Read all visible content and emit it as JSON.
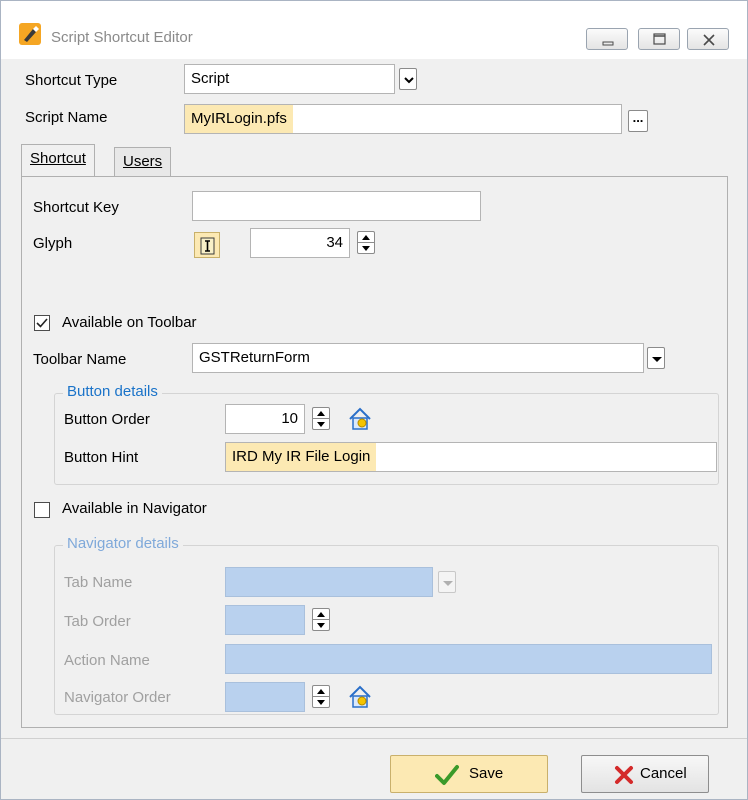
{
  "window": {
    "title": "Script Shortcut Editor",
    "buttons": [
      "minimize",
      "maximize",
      "close"
    ]
  },
  "form": {
    "shortcut_type_label": "Shortcut Type",
    "shortcut_type_value": "Script",
    "script_name_label": "Script Name",
    "script_name_value": "MyIRLogin.pfs",
    "browse_label": "..."
  },
  "tabs": [
    {
      "label": "Shortcut",
      "active": true
    },
    {
      "label": "Users",
      "active": false
    }
  ],
  "shortcut_tab": {
    "shortcut_key_label": "Shortcut Key",
    "shortcut_key_value": "",
    "glyph_label": "Glyph",
    "glyph_value": "34",
    "available_on_toolbar_label": "Available on Toolbar",
    "available_on_toolbar_checked": true,
    "toolbar_name_label": "Toolbar Name",
    "toolbar_name_value": "GSTReturnForm",
    "button_details": {
      "title": "Button details",
      "button_order_label": "Button Order",
      "button_order_value": "10",
      "button_hint_label": "Button Hint",
      "button_hint_value": "IRD My IR File Login"
    },
    "available_in_navigator_label": "Available in Navigator",
    "available_in_navigator_checked": false,
    "navigator_details": {
      "title": "Navigator details",
      "tab_name_label": "Tab Name",
      "tab_order_label": "Tab Order",
      "action_name_label": "Action Name",
      "navigator_order_label": "Navigator Order"
    }
  },
  "footer": {
    "save_label": "Save",
    "cancel_label": "Cancel"
  },
  "colors": {
    "highlight": "#fce9b3",
    "disabled_field": "#b9d1ee",
    "group_title": "#1a73c9",
    "save_check": "#3a9a2a",
    "cancel_x": "#d42a2a"
  }
}
